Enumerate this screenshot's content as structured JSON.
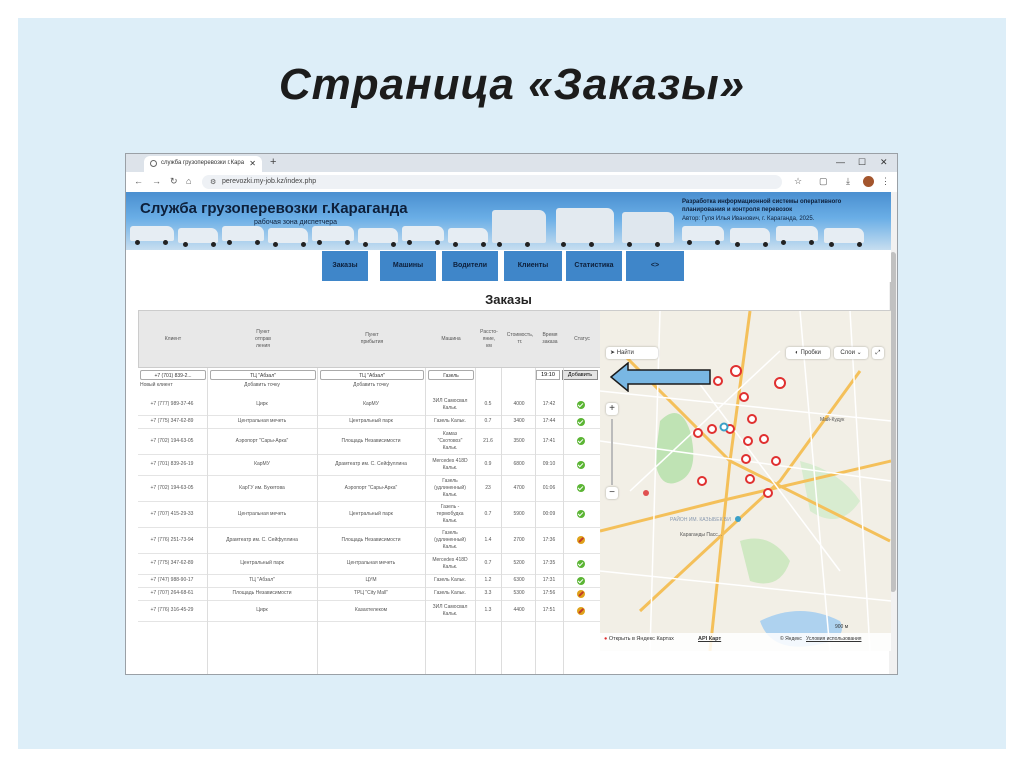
{
  "slide": {
    "title": "Страница «Заказы»"
  },
  "browser": {
    "tab_title": "служба грузоперевозки г.Кара",
    "url": "perevozki.my-job.kz/index.php"
  },
  "site": {
    "title": "Служба грузоперевозки г.Караганда",
    "subtitle": "рабочая зона диспетчера",
    "right_line1": "Разработка информационной системы оперативного",
    "right_line2": "планирования и контроля перевозок",
    "right_line3": "Автор: Гуля Илья Иванович, г. Караганда, 2025."
  },
  "nav": [
    {
      "label": "Заказы"
    },
    {
      "label": "Машины"
    },
    {
      "label": "Водители"
    },
    {
      "label": "Клиенты"
    },
    {
      "label": "Статистика"
    },
    {
      "label": "<>"
    }
  ],
  "page_heading": "Заказы",
  "table": {
    "headers": [
      "Клиент",
      "Пункт\nотправ\nления",
      "Пункт\nприбытия",
      "Машина",
      "Рассто-\nяние,\nкм",
      "Стоимость,\nтг.",
      "Время\nзаказа",
      "Статус"
    ],
    "filter": {
      "client": "+7 (701) 839-2...",
      "from": "ТЦ \"Абзал\"",
      "to": "ТЦ \"Абзал\"",
      "car": "Газель",
      "time": "19:10",
      "add_label": "Добавить"
    },
    "sub": {
      "client": "Новый клиент",
      "from": "Добавить точку",
      "to": "Добавить точку"
    },
    "rows": [
      {
        "client": "+7 (777) 989-37-46",
        "from": "Цирк",
        "to": "КарМУ",
        "car": "ЗИЛ Самосвал\nКальк.",
        "dist": "0.5",
        "cost": "4000",
        "time": "17:42",
        "status": "ok"
      },
      {
        "client": "+7 (775) 347-62-89",
        "from": "Центральная мечеть",
        "to": "Центральный парк",
        "car": "Газель  Кальк.",
        "dist": "0.7",
        "cost": "3400",
        "time": "17:44",
        "status": "ok"
      },
      {
        "client": "+7 (702) 194-63-05",
        "from": "Аэропорт \"Сары-Арка\"",
        "to": "Площадь Независимости",
        "car": "Камаз\n\"Скотовоз\"\nКальк.",
        "dist": "21.6",
        "cost": "3500",
        "time": "17:41",
        "status": "ok"
      },
      {
        "client": "+7 (701) 839-26-19",
        "from": "КарМУ",
        "to": "Драмтеатр им. С. Сейфуллина",
        "car": "Mercedes 418D\nКальк.",
        "dist": "0.9",
        "cost": "6800",
        "time": "09:10",
        "status": "ok"
      },
      {
        "client": "+7 (702) 194-63-05",
        "from": "КарГУ им. Букетова",
        "to": "Аэропорт \"Сары-Арка\"",
        "car": "Газель\n(удлиненный)\nКальк.",
        "dist": "23",
        "cost": "4700",
        "time": "01:06",
        "status": "ok"
      },
      {
        "client": "+7 (707) 415-29-33",
        "from": "Центральная мечеть",
        "to": "Центральный парк",
        "car": "Газель -\nтермобудка\nКальк.",
        "dist": "0.7",
        "cost": "5900",
        "time": "00:09",
        "status": "ok"
      },
      {
        "client": "+7 (776) 251-73-94",
        "from": "Драмтеатр им. С. Сейфуллина",
        "to": "Площадь Независимости",
        "car": "Газель\n(удлиненный)\nКальк.",
        "dist": "1.4",
        "cost": "2700",
        "time": "17:36",
        "status": "no"
      },
      {
        "client": "+7 (775) 347-62-89",
        "from": "Центральный парк",
        "to": "Центральная мечеть",
        "car": "Mercedes 418D\nКальк.",
        "dist": "0.7",
        "cost": "5200",
        "time": "17:35",
        "status": "ok"
      },
      {
        "client": "+7 (747) 988-90-17",
        "from": "ТЦ \"Абзал\"",
        "to": "ЦУМ",
        "car": "Газель  Кальк.",
        "dist": "1.2",
        "cost": "6300",
        "time": "17:31",
        "status": "ok"
      },
      {
        "client": "+7 (707) 264-68-61",
        "from": "Площадь Независимости",
        "to": "ТРЦ \"City Mall\"",
        "car": "Газель  Кальк.",
        "dist": "3.3",
        "cost": "5300",
        "time": "17:56",
        "status": "no"
      },
      {
        "client": "+7 (776) 316-45-29",
        "from": "Цирк",
        "to": "Казахтелеком",
        "car": "ЗИЛ Самосвал\nКальк.",
        "dist": "1.3",
        "cost": "4400",
        "time": "17:51",
        "status": "no"
      }
    ]
  },
  "map": {
    "find": "Найти",
    "traffic": "Пробки",
    "layers": "Слои",
    "open_link": "Открыть в Яндекс Картах",
    "api": "API Карт",
    "scale": "900 м",
    "copyright": "© Яндекс",
    "terms": "Условия использования",
    "district": "РАЙОН ИМ.\nКАЗЫБЕК БИ",
    "mall": "Караганды Пасс...",
    "area1": "Май-Кудук"
  },
  "colors": {
    "slide_bg": "#ddeef8",
    "nav_blue": "#3f86c9",
    "status_ok": "#5bb534",
    "status_cancel": "#e0a21a",
    "map_marker": "#e03030",
    "arrow": "#79b7e3"
  }
}
